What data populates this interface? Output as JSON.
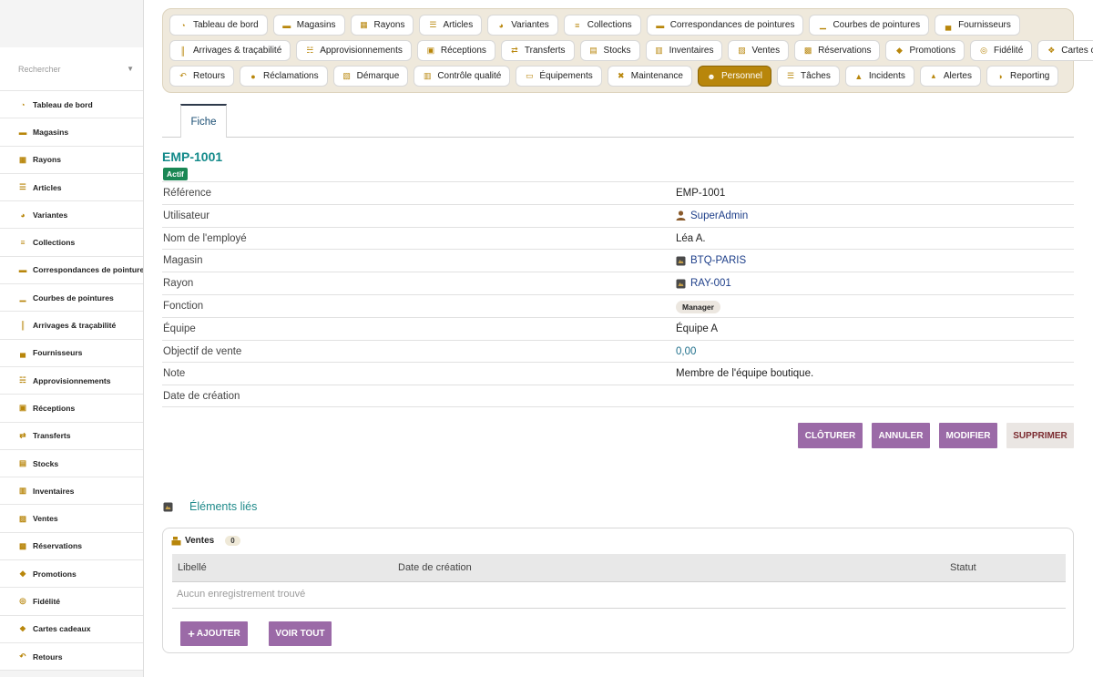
{
  "search": {
    "placeholder": "Rechercher"
  },
  "sidebar": {
    "items": [
      {
        "label": "Tableau de bord",
        "icon": "dashboard-icon"
      },
      {
        "label": "Magasins",
        "icon": "store-icon"
      },
      {
        "label": "Rayons",
        "icon": "grid-icon"
      },
      {
        "label": "Articles",
        "icon": "shoe-icon"
      },
      {
        "label": "Variantes",
        "icon": "palette-icon"
      },
      {
        "label": "Collections",
        "icon": "layers-icon"
      },
      {
        "label": "Correspondances de pointures",
        "icon": "ruler-icon"
      },
      {
        "label": "Courbes de pointures",
        "icon": "chart-icon"
      },
      {
        "label": "Arrivages & traçabilité",
        "icon": "barcode-icon"
      },
      {
        "label": "Fournisseurs",
        "icon": "factory-icon"
      },
      {
        "label": "Approvisionnements",
        "icon": "cart-icon"
      },
      {
        "label": "Réceptions",
        "icon": "truck-icon"
      },
      {
        "label": "Transferts",
        "icon": "transfer-icon"
      },
      {
        "label": "Stocks",
        "icon": "box-icon"
      },
      {
        "label": "Inventaires",
        "icon": "clipboard-icon"
      },
      {
        "label": "Ventes",
        "icon": "cash-register-icon"
      },
      {
        "label": "Réservations",
        "icon": "calendar-check-icon"
      },
      {
        "label": "Promotions",
        "icon": "tag-icon"
      },
      {
        "label": "Fidélité",
        "icon": "medal-icon"
      },
      {
        "label": "Cartes cadeaux",
        "icon": "gift-icon"
      },
      {
        "label": "Retours",
        "icon": "undo-icon"
      }
    ]
  },
  "menu": {
    "rows": [
      [
        {
          "label": "Tableau de bord",
          "icon": "dashboard-icon"
        },
        {
          "label": "Magasins",
          "icon": "store-icon"
        },
        {
          "label": "Rayons",
          "icon": "grid-icon"
        },
        {
          "label": "Articles",
          "icon": "shoe-icon"
        },
        {
          "label": "Variantes",
          "icon": "palette-icon"
        },
        {
          "label": "Collections",
          "icon": "layers-icon"
        },
        {
          "label": "Correspondances de pointures",
          "icon": "ruler-icon"
        },
        {
          "label": "Courbes de pointures",
          "icon": "chart-icon"
        },
        {
          "label": "Fournisseurs",
          "icon": "factory-icon"
        }
      ],
      [
        {
          "label": "Arrivages & traçabilité",
          "icon": "barcode-icon"
        },
        {
          "label": "Approvisionnements",
          "icon": "cart-icon"
        },
        {
          "label": "Réceptions",
          "icon": "truck-icon"
        },
        {
          "label": "Transferts",
          "icon": "transfer-icon"
        },
        {
          "label": "Stocks",
          "icon": "box-icon"
        },
        {
          "label": "Inventaires",
          "icon": "clipboard-icon"
        },
        {
          "label": "Ventes",
          "icon": "cash-register-icon"
        },
        {
          "label": "Réservations",
          "icon": "calendar-check-icon"
        },
        {
          "label": "Promotions",
          "icon": "tag-icon"
        },
        {
          "label": "Fidélité",
          "icon": "medal-icon"
        },
        {
          "label": "Cartes cadeaux",
          "icon": "gift-icon"
        }
      ],
      [
        {
          "label": "Retours",
          "icon": "undo-icon"
        },
        {
          "label": "Réclamations",
          "icon": "comment-icon"
        },
        {
          "label": "Démarque",
          "icon": "document-icon"
        },
        {
          "label": "Contrôle qualité",
          "icon": "checklist-icon"
        },
        {
          "label": "Équipements",
          "icon": "monitor-icon"
        },
        {
          "label": "Maintenance",
          "icon": "tools-icon"
        },
        {
          "label": "Personnel",
          "icon": "users-icon",
          "active": true
        },
        {
          "label": "Tâches",
          "icon": "list-icon"
        },
        {
          "label": "Incidents",
          "icon": "warning-icon"
        },
        {
          "label": "Alertes",
          "icon": "bell-icon"
        },
        {
          "label": "Reporting",
          "icon": "pie-chart-icon"
        }
      ]
    ]
  },
  "tabs": {
    "fiche": "Fiche"
  },
  "record": {
    "title": "EMP-1001",
    "status": "Actif",
    "fields": [
      {
        "label": "Référence",
        "value": "EMP-1001"
      },
      {
        "label": "Utilisateur",
        "value": "SuperAdmin",
        "icon": "user-icon"
      },
      {
        "label": "Nom de l'employé",
        "value": "Léa A."
      },
      {
        "label": "Magasin",
        "value": "BTQ-PARIS",
        "icon": "store-link-icon"
      },
      {
        "label": "Rayon",
        "value": "RAY-001",
        "icon": "aisle-link-icon"
      },
      {
        "label": "Fonction",
        "value": "Manager"
      },
      {
        "label": "Équipe",
        "value": "Équipe A"
      },
      {
        "label": "Objectif de vente",
        "value": "0,00"
      },
      {
        "label": "Note",
        "value": "Membre de l'équipe boutique."
      },
      {
        "label": "Date de création",
        "value": ""
      }
    ]
  },
  "actions": {
    "close": "CLÔTURER",
    "cancel": "ANNULER",
    "edit": "MODIFIER",
    "delete": "SUPPRIMER"
  },
  "related": {
    "title": "Éléments liés",
    "panel_title": "Ventes",
    "count": "0",
    "columns": [
      "Libellé",
      "Date de création",
      "Statut"
    ],
    "empty": "Aucun enregistrement trouvé",
    "add": "AJOUTER",
    "view_all": "VOIR TOUT"
  },
  "colors": {
    "accent": "#b8860b",
    "menu_bg": "#efe9dc",
    "action": "#9b6aa7",
    "title": "#138a8a",
    "status": "#198754"
  }
}
